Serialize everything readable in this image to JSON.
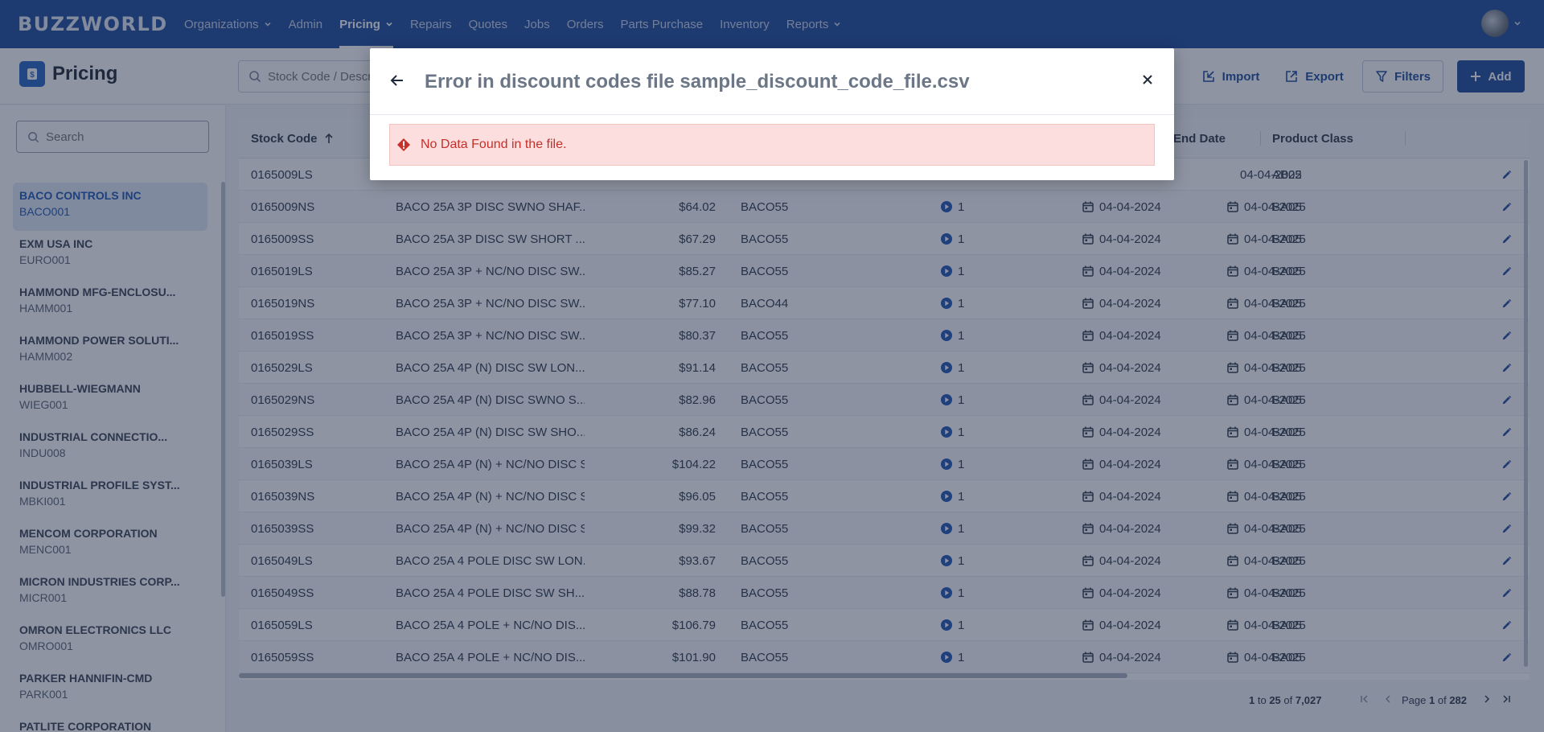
{
  "app": {
    "logo_text": "BUZZWORLD"
  },
  "nav": {
    "items": [
      {
        "label": "Organizations",
        "dropdown": true,
        "active": false
      },
      {
        "label": "Admin",
        "dropdown": false,
        "active": false
      },
      {
        "label": "Pricing",
        "dropdown": true,
        "active": true
      },
      {
        "label": "Repairs",
        "dropdown": false,
        "active": false
      },
      {
        "label": "Quotes",
        "dropdown": false,
        "active": false
      },
      {
        "label": "Jobs",
        "dropdown": false,
        "active": false
      },
      {
        "label": "Orders",
        "dropdown": false,
        "active": false
      },
      {
        "label": "Parts Purchase",
        "dropdown": false,
        "active": false
      },
      {
        "label": "Inventory",
        "dropdown": false,
        "active": false
      },
      {
        "label": "Reports",
        "dropdown": true,
        "active": false
      }
    ]
  },
  "header": {
    "title": "Pricing",
    "search_placeholder": "Stock Code / Description",
    "import_label": "Import",
    "export_label": "Export",
    "filters_label": "Filters",
    "add_label": "Add"
  },
  "sidebar": {
    "search_placeholder": "Search",
    "items": [
      {
        "name": "BACO CONTROLS INC",
        "code": "BACO001",
        "selected": true
      },
      {
        "name": "EXM USA INC",
        "code": "EURO001",
        "selected": false
      },
      {
        "name": "HAMMOND MFG-ENCLOSU...",
        "code": "HAMM001",
        "selected": false
      },
      {
        "name": "HAMMOND POWER SOLUTI...",
        "code": "HAMM002",
        "selected": false
      },
      {
        "name": "HUBBELL-WIEGMANN",
        "code": "WIEG001",
        "selected": false
      },
      {
        "name": "INDUSTRIAL CONNECTIO...",
        "code": "INDU008",
        "selected": false
      },
      {
        "name": "INDUSTRIAL PROFILE SYST...",
        "code": "MBKI001",
        "selected": false
      },
      {
        "name": "MENCOM CORPORATION",
        "code": "MENC001",
        "selected": false
      },
      {
        "name": "MICRON INDUSTRIES CORP...",
        "code": "MICR001",
        "selected": false
      },
      {
        "name": "OMRON ELECTRONICS LLC",
        "code": "OMRO001",
        "selected": false
      },
      {
        "name": "PARKER HANNIFIN-CMD",
        "code": "PARK001",
        "selected": false
      },
      {
        "name": "PATLITE CORPORATION",
        "code": "",
        "selected": false
      }
    ]
  },
  "grid": {
    "headers": {
      "stock_code": "Stock Code",
      "end_date": "End Date",
      "product_class": "Product Class"
    },
    "rows": [
      {
        "stock": "0165009LS",
        "desc": "",
        "price": "",
        "code": "",
        "qty": "",
        "start": "",
        "end": "04-04-2025",
        "cls": "AB02"
      },
      {
        "stock": "0165009NS",
        "desc": "BACO 25A 3P DISC SWNO SHAF...",
        "price": "$64.02",
        "code": "BACO55",
        "qty": "1",
        "start": "04-04-2024",
        "end": "04-04-2025",
        "cls": "BA05"
      },
      {
        "stock": "0165009SS",
        "desc": "BACO 25A 3P DISC SW SHORT ...",
        "price": "$67.29",
        "code": "BACO55",
        "qty": "1",
        "start": "04-04-2024",
        "end": "04-04-2025",
        "cls": "BA05"
      },
      {
        "stock": "0165019LS",
        "desc": "BACO 25A 3P + NC/NO DISC SW...",
        "price": "$85.27",
        "code": "BACO55",
        "qty": "1",
        "start": "04-04-2024",
        "end": "04-04-2025",
        "cls": "BA05"
      },
      {
        "stock": "0165019NS",
        "desc": "BACO 25A 3P + NC/NO DISC SW...",
        "price": "$77.10",
        "code": "BACO44",
        "qty": "1",
        "start": "04-04-2024",
        "end": "04-04-2025",
        "cls": "BA05"
      },
      {
        "stock": "0165019SS",
        "desc": "BACO 25A 3P + NC/NO DISC SW...",
        "price": "$80.37",
        "code": "BACO55",
        "qty": "1",
        "start": "04-04-2024",
        "end": "04-04-2025",
        "cls": "BA05"
      },
      {
        "stock": "0165029LS",
        "desc": "BACO 25A 4P (N) DISC SW LON...",
        "price": "$91.14",
        "code": "BACO55",
        "qty": "1",
        "start": "04-04-2024",
        "end": "04-04-2025",
        "cls": "BA05"
      },
      {
        "stock": "0165029NS",
        "desc": "BACO 25A 4P (N) DISC SWNO S...",
        "price": "$82.96",
        "code": "BACO55",
        "qty": "1",
        "start": "04-04-2024",
        "end": "04-04-2025",
        "cls": "BA05"
      },
      {
        "stock": "0165029SS",
        "desc": "BACO 25A 4P (N) DISC SW SHO...",
        "price": "$86.24",
        "code": "BACO55",
        "qty": "1",
        "start": "04-04-2024",
        "end": "04-04-2025",
        "cls": "BA05"
      },
      {
        "stock": "0165039LS",
        "desc": "BACO 25A 4P (N) + NC/NO DISC S",
        "price": "$104.22",
        "code": "BACO55",
        "qty": "1",
        "start": "04-04-2024",
        "end": "04-04-2025",
        "cls": "BA05"
      },
      {
        "stock": "0165039NS",
        "desc": "BACO 25A 4P (N) + NC/NO DISC S",
        "price": "$96.05",
        "code": "BACO55",
        "qty": "1",
        "start": "04-04-2024",
        "end": "04-04-2025",
        "cls": "BA05"
      },
      {
        "stock": "0165039SS",
        "desc": "BACO 25A 4P (N) + NC/NO DISC S",
        "price": "$99.32",
        "code": "BACO55",
        "qty": "1",
        "start": "04-04-2024",
        "end": "04-04-2025",
        "cls": "BA05"
      },
      {
        "stock": "0165049LS",
        "desc": "BACO 25A 4 POLE DISC SW LON...",
        "price": "$93.67",
        "code": "BACO55",
        "qty": "1",
        "start": "04-04-2024",
        "end": "04-04-2025",
        "cls": "BA05"
      },
      {
        "stock": "0165049SS",
        "desc": "BACO 25A 4 POLE DISC SW SH...",
        "price": "$88.78",
        "code": "BACO55",
        "qty": "1",
        "start": "04-04-2024",
        "end": "04-04-2025",
        "cls": "BA05"
      },
      {
        "stock": "0165059LS",
        "desc": "BACO 25A 4 POLE + NC/NO DIS...",
        "price": "$106.79",
        "code": "BACO55",
        "qty": "1",
        "start": "04-04-2024",
        "end": "04-04-2025",
        "cls": "BA05"
      },
      {
        "stock": "0165059SS",
        "desc": "BACO 25A 4 POLE + NC/NO DIS...",
        "price": "$101.90",
        "code": "BACO55",
        "qty": "1",
        "start": "04-04-2024",
        "end": "04-04-2025",
        "cls": "BA05"
      }
    ]
  },
  "pager": {
    "from": "1",
    "to_word": "to",
    "to": "25",
    "of_word": "of",
    "total": "7,027",
    "page_word": "Page",
    "page": "1",
    "of_word2": "of",
    "pages": "282"
  },
  "modal": {
    "title": "Error in discount codes file sample_discount_code_file.csv",
    "message": "No Data Found in the file."
  },
  "colors": {
    "brand": "#1c4a9c",
    "accent": "#2566c2",
    "error_bg": "#fbdedd",
    "error_text": "#c5302a"
  }
}
